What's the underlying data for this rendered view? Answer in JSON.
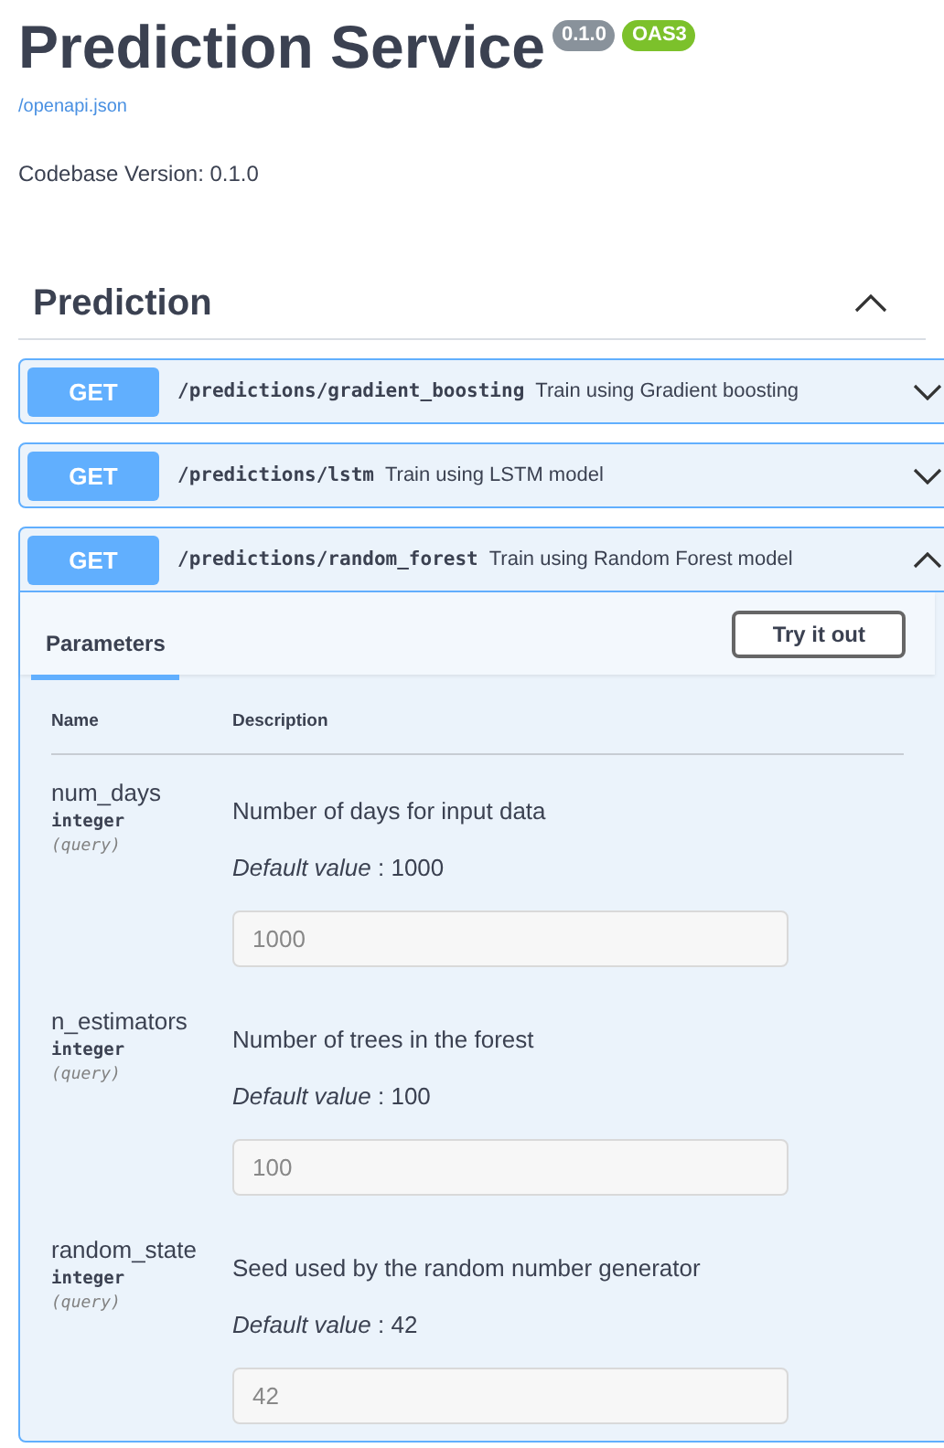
{
  "header": {
    "title": "Prediction Service",
    "badges": [
      {
        "text": "0.1.0",
        "color": "#89929b"
      },
      {
        "text": "OAS3",
        "color": "#7cc12b"
      }
    ],
    "link": "/openapi.json",
    "description": "Codebase Version: 0.1.0"
  },
  "section": {
    "title": "Prediction",
    "expanded": true,
    "operations": [
      {
        "method": "GET",
        "path": "/predictions/gradient_boosting",
        "summary": "Train using Gradient boosting",
        "expanded": false
      },
      {
        "method": "GET",
        "path": "/predictions/lstm",
        "summary": "Train using LSTM model",
        "expanded": false
      },
      {
        "method": "GET",
        "path": "/predictions/random_forest",
        "summary": "Train using Random Forest model",
        "expanded": true,
        "tabs": [
          {
            "label": "Parameters",
            "selected": true
          }
        ],
        "try_button": "Try it out",
        "columns": [
          "Name",
          "Description"
        ],
        "parameters": [
          {
            "name": "num_days",
            "type": "integer",
            "location": "(query)",
            "description": "Number of days for input data",
            "default": "*Default value* : 1000",
            "value": "1000",
            "disabled": true
          },
          {
            "name": "n_estimators",
            "type": "integer",
            "location": "(query)",
            "description": "Number of trees in the forest",
            "default": "*Default value* : 100",
            "value": "100",
            "disabled": true
          },
          {
            "name": "random_state",
            "type": "integer",
            "location": "(query)",
            "description": "Seed used by the random number generator",
            "default": "*Default value* : 42",
            "value": "42",
            "disabled": true
          }
        ]
      }
    ]
  }
}
